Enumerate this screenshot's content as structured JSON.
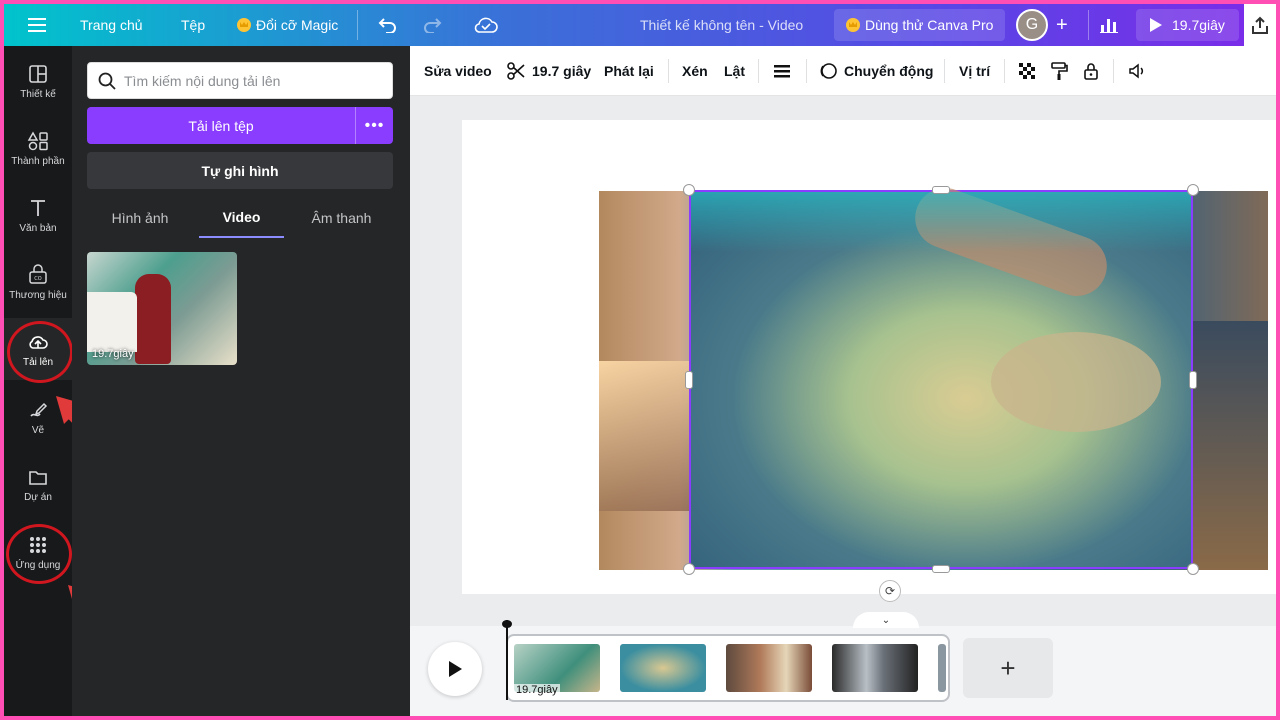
{
  "topbar": {
    "home": "Trang chủ",
    "file": "Tệp",
    "magic_resize": "Đổi cỡ Magic",
    "doc_title": "Thiết kế không tên - Video",
    "try_pro": "Dùng thử Canva Pro",
    "avatar_initial": "G",
    "play_duration": "19.7giây"
  },
  "rail": {
    "items": [
      {
        "label": "Thiết kế",
        "icon": "layout-icon"
      },
      {
        "label": "Thành phần",
        "icon": "elements-icon"
      },
      {
        "label": "Văn bản",
        "icon": "text-icon"
      },
      {
        "label": "Thương hiệu",
        "icon": "brand-icon"
      },
      {
        "label": "Tải lên",
        "icon": "upload-cloud-icon"
      },
      {
        "label": "Vẽ",
        "icon": "draw-icon"
      },
      {
        "label": "Dự án",
        "icon": "folder-icon"
      },
      {
        "label": "Ứng dụng",
        "icon": "apps-grid-icon"
      }
    ],
    "active": "Tải lên"
  },
  "panel": {
    "search_placeholder": "Tìm kiếm nội dung tải lên",
    "upload_button": "Tải lên tệp",
    "more_button": "•••",
    "record_button": "Tự ghi hình",
    "tabs": [
      "Hình ảnh",
      "Video",
      "Âm thanh"
    ],
    "active_tab": "Video",
    "uploads": [
      {
        "duration": "19.7giây"
      }
    ]
  },
  "toolbar": {
    "edit_video": "Sửa video",
    "trim_duration": "19.7 giây",
    "playback": "Phát lại",
    "crop": "Xén",
    "flip": "Lật",
    "animate": "Chuyển động",
    "position": "Vị trí"
  },
  "timeline": {
    "clip_duration": "19.7giây",
    "add_label": "+"
  },
  "colors": {
    "accent": "#8b3dff",
    "annotation_red": "#d0161e",
    "border_pink": "#ff4fb5"
  }
}
